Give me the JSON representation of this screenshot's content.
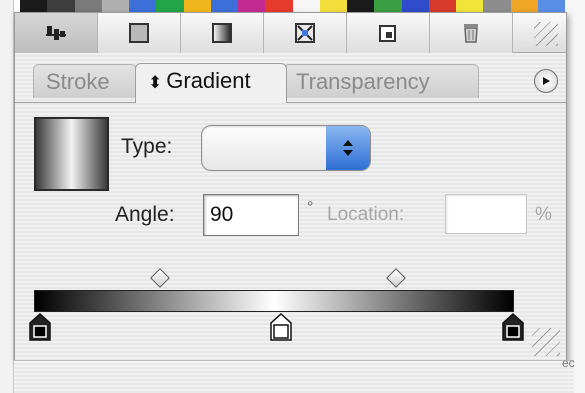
{
  "top_swatch_colors": [
    "#1b1b1b",
    "#3d3d3d",
    "#7a7a7a",
    "#b0b0b0",
    "#3c6fd8",
    "#22a547",
    "#f1b81d",
    "#3c6fd8",
    "#c42b92",
    "#e63b2e",
    "#f6f6f6",
    "#f4df3c",
    "#1b1b1b",
    "#3a9e44",
    "#2e4ccb",
    "#d63b2b",
    "#f2e53a",
    "#8d8d8d",
    "#f0a727",
    "#5a8ee6"
  ],
  "toolbar": {
    "buttons": [
      {
        "name": "align-icon"
      },
      {
        "name": "swatch-solid-icon"
      },
      {
        "name": "swatch-gradient-icon"
      },
      {
        "name": "swatch-pattern-icon"
      },
      {
        "name": "new-swatch-icon"
      },
      {
        "name": "trash-icon"
      }
    ]
  },
  "tabs": [
    {
      "label": "Stroke"
    },
    {
      "label": "Gradient",
      "arrows": "⬍",
      "active": true
    },
    {
      "label": "Transparency"
    }
  ],
  "gradient_panel": {
    "type_label": "Type:",
    "type_value": "",
    "angle_label": "Angle:",
    "angle_value": "90",
    "degree_symbol": "°",
    "location_label": "Location:",
    "location_value": "",
    "percent_symbol": "%"
  },
  "below_text": "ec",
  "colors": {
    "accent_blue": "#3f7ce0",
    "panel_bg": "#ececec"
  }
}
